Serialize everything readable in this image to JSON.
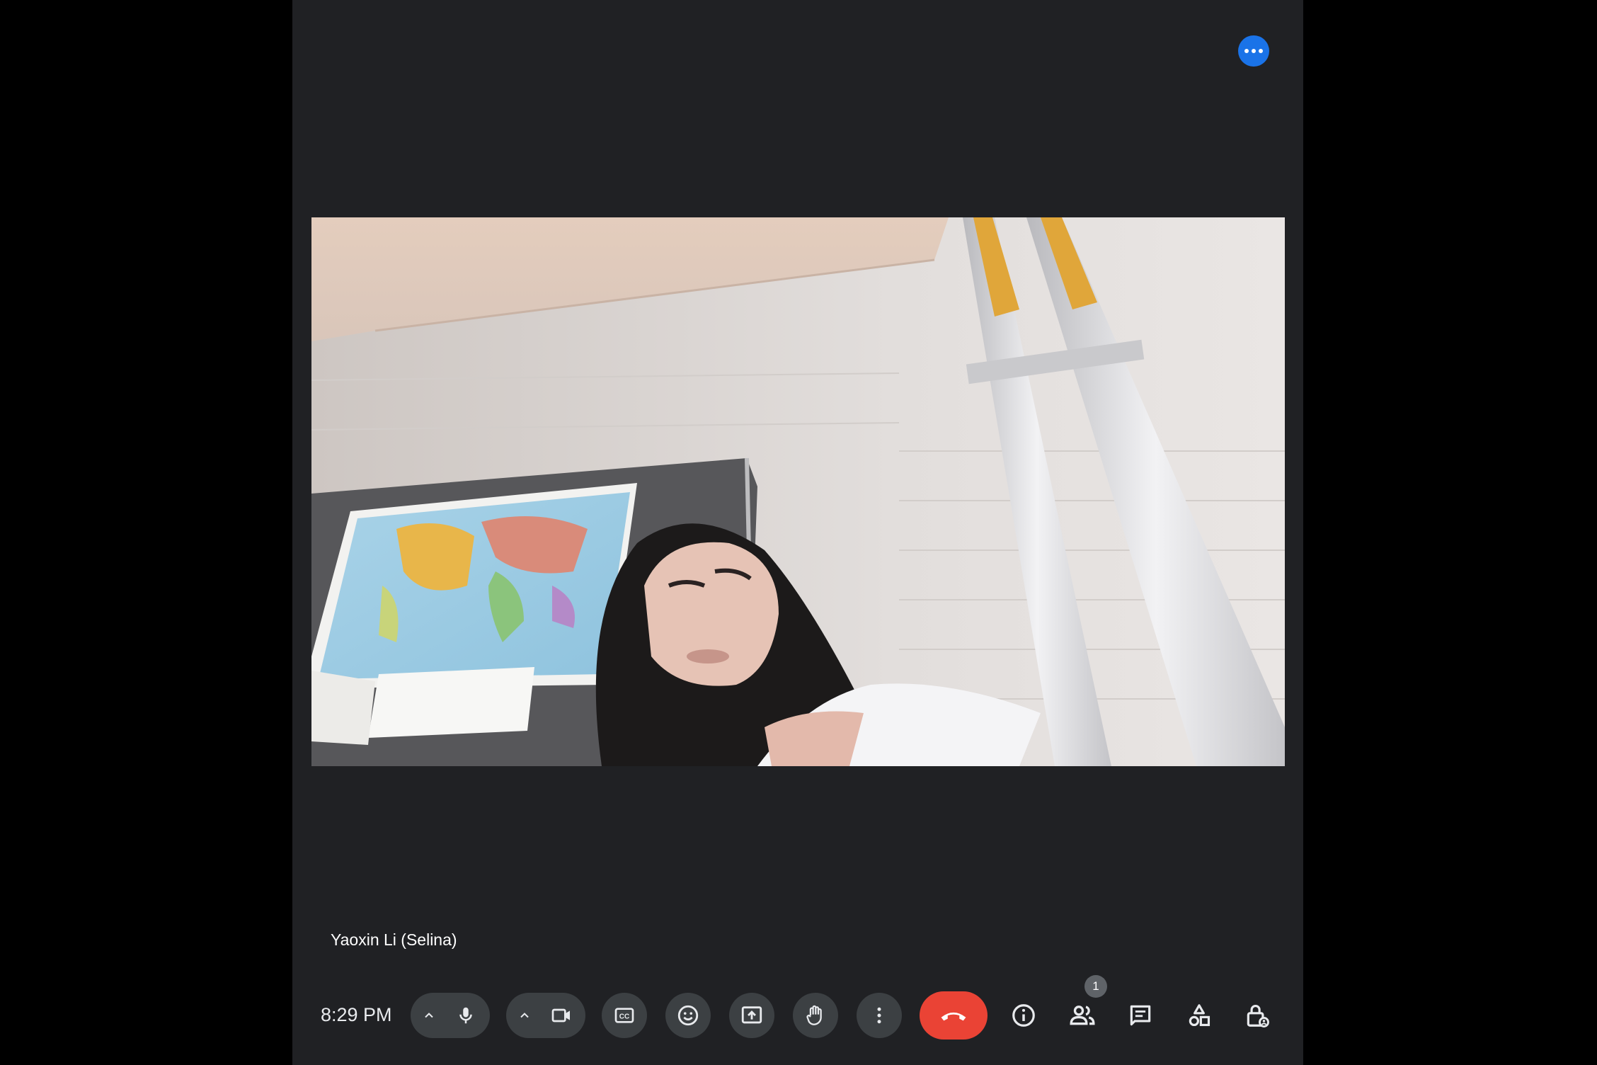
{
  "participant": {
    "name": "Yaoxin Li (Selina)"
  },
  "toolbar": {
    "time": "8:29 PM",
    "participant_count": "1"
  },
  "icons": [
    "more-horizontal-icon",
    "chevron-up-icon",
    "mic-icon",
    "video-camera-icon",
    "closed-captions-icon",
    "emoji-icon",
    "present-screen-icon",
    "raise-hand-icon",
    "more-vert-icon",
    "call-end-icon",
    "info-icon",
    "people-icon",
    "chat-icon",
    "activities-icon",
    "host-controls-icon"
  ],
  "colors": {
    "background": "#202124",
    "button": "#3c4043",
    "end_call": "#ea4335",
    "accent": "#1a73e8"
  }
}
